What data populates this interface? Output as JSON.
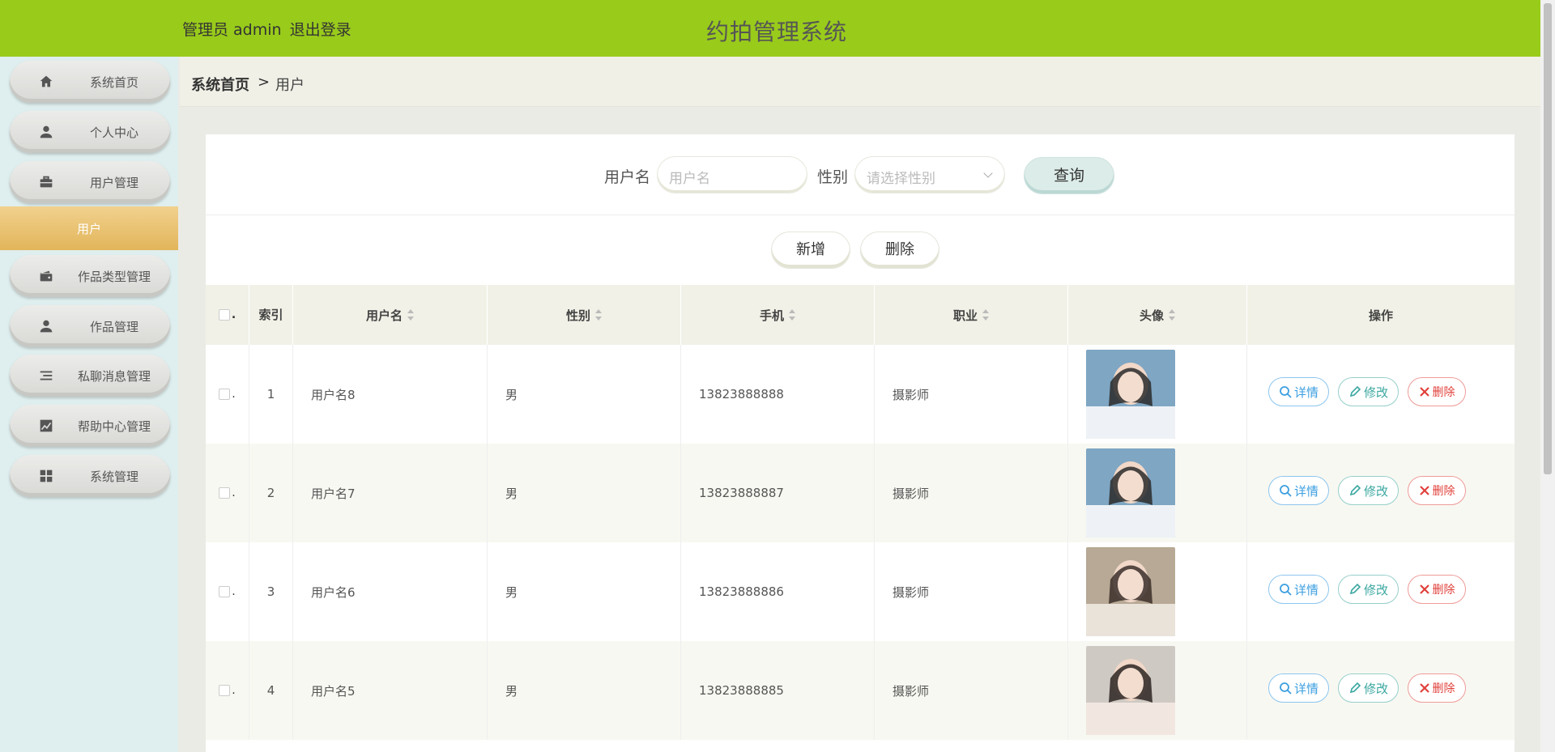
{
  "header": {
    "user_label": "管理员 admin",
    "logout": "退出登录",
    "title": "约拍管理系统"
  },
  "sidebar": {
    "items": [
      {
        "label": "系统首页",
        "icon": "home-icon"
      },
      {
        "label": "个人中心",
        "icon": "person-icon"
      },
      {
        "label": "用户管理",
        "icon": "briefcase-icon"
      },
      {
        "label": "用户",
        "icon": ""
      },
      {
        "label": "作品类型管理",
        "icon": "wallet-icon"
      },
      {
        "label": "作品管理",
        "icon": "person-icon"
      },
      {
        "label": "私聊消息管理",
        "icon": "list-icon"
      },
      {
        "label": "帮助中心管理",
        "icon": "chart-icon"
      },
      {
        "label": "系统管理",
        "icon": "grid-icon"
      }
    ]
  },
  "breadcrumb": {
    "home": "系统首页",
    "separator": ">",
    "current": "用户"
  },
  "search": {
    "username_label": "用户名",
    "username_placeholder": "用户名",
    "gender_label": "性别",
    "gender_placeholder": "请选择性别",
    "query_button": "查询"
  },
  "actions": {
    "add": "新增",
    "delete": "删除"
  },
  "table": {
    "headers": {
      "index": "索引",
      "username": "用户名",
      "gender": "性别",
      "phone": "手机",
      "job": "职业",
      "avatar": "头像",
      "ops": "操作"
    },
    "op_labels": {
      "detail": "详情",
      "edit": "修改",
      "delete": "删除"
    },
    "rows": [
      {
        "index": "1",
        "username": "用户名8",
        "gender": "男",
        "phone": "13823888888",
        "job": "摄影师"
      },
      {
        "index": "2",
        "username": "用户名7",
        "gender": "男",
        "phone": "13823888887",
        "job": "摄影师"
      },
      {
        "index": "3",
        "username": "用户名6",
        "gender": "男",
        "phone": "13823888886",
        "job": "摄影师"
      },
      {
        "index": "4",
        "username": "用户名5",
        "gender": "男",
        "phone": "13823888885",
        "job": "摄影师"
      }
    ]
  },
  "colors": {
    "header_bg": "#99cb1b",
    "sidebar_bg": "#dfeeee",
    "active_menu": "#e8c06a",
    "table_head_bg": "#f2f1e7"
  }
}
